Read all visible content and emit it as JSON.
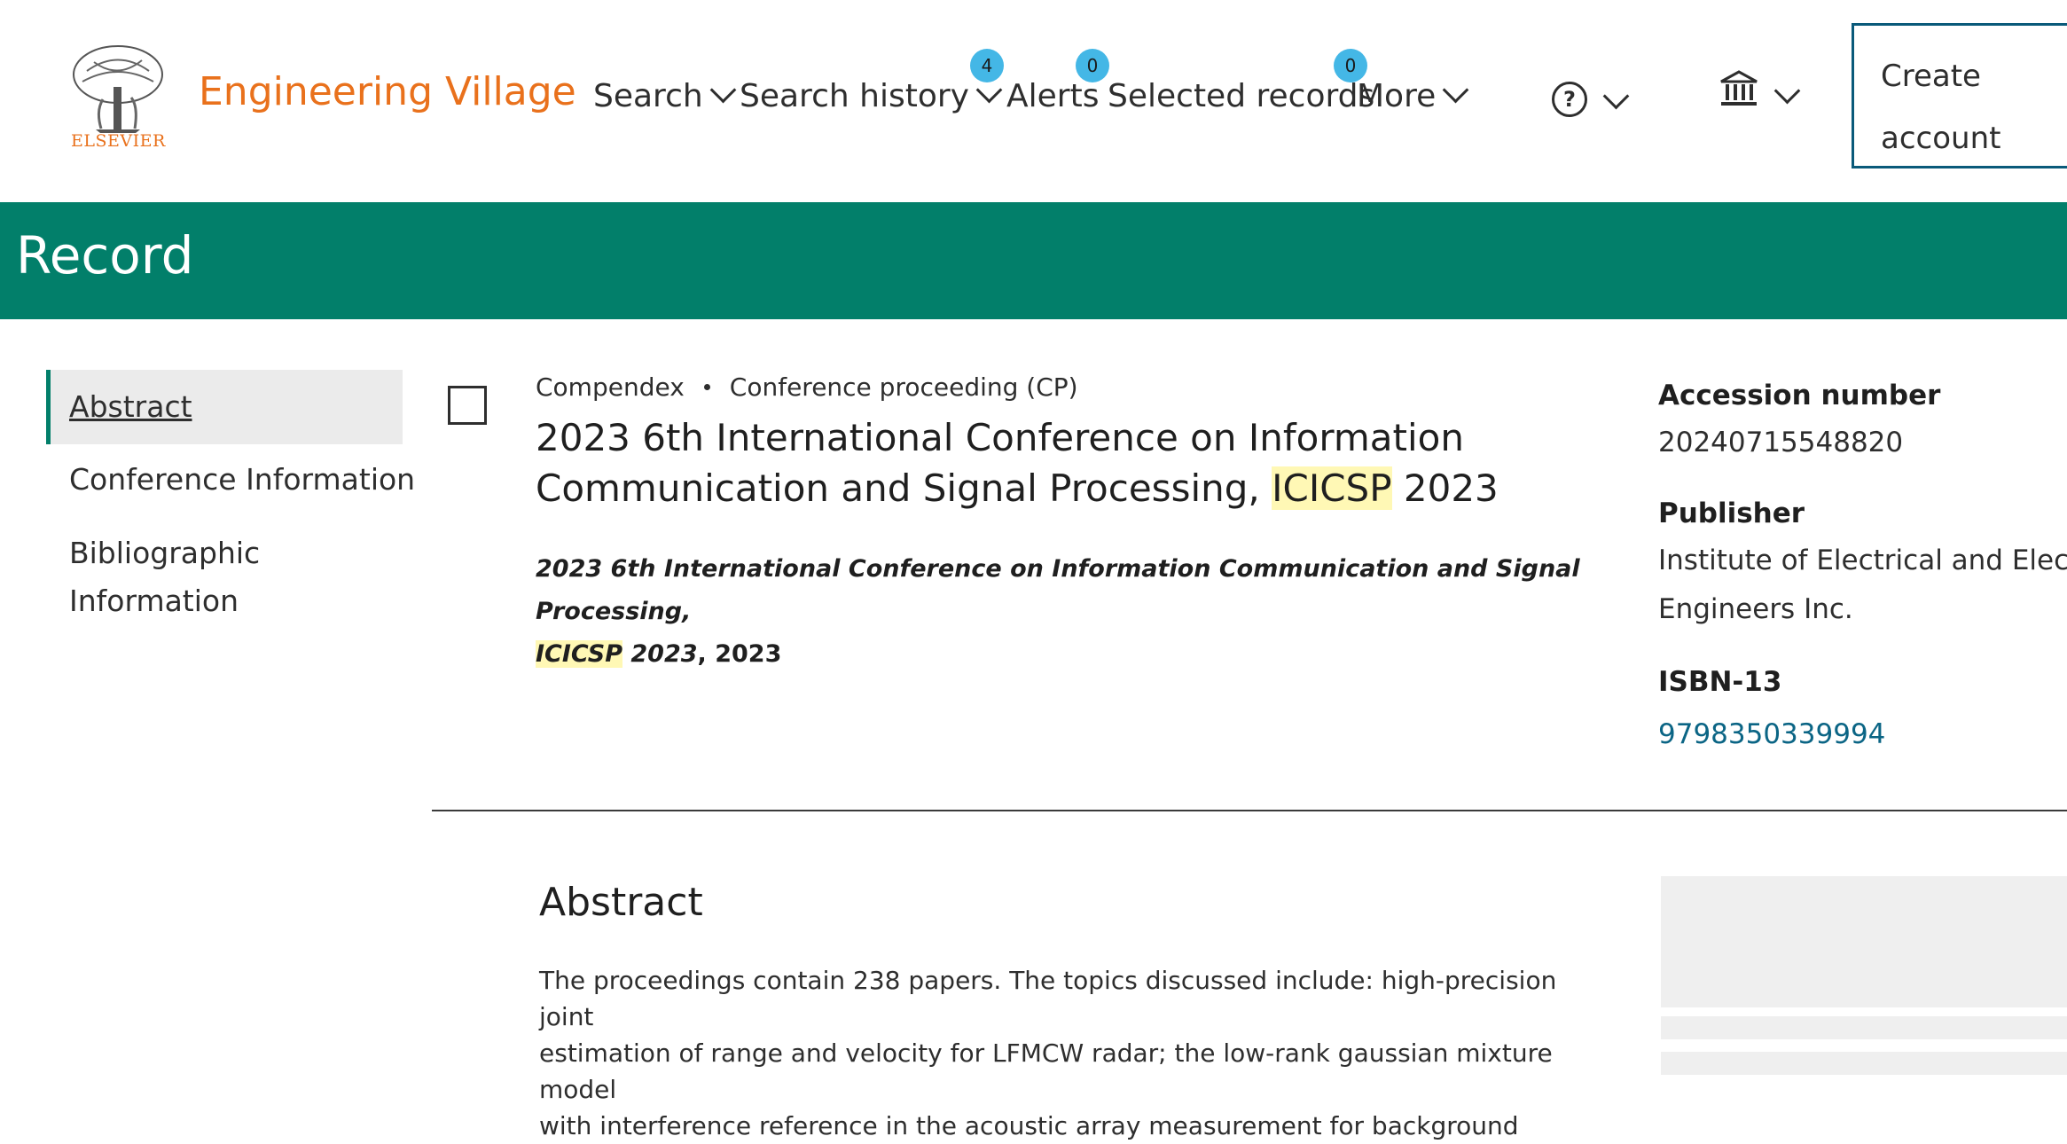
{
  "header": {
    "logo_text": "ELSEVIER",
    "brand": "Engineering Village",
    "nav": {
      "search": "Search",
      "search_history": "Search history",
      "search_history_count": "4",
      "alerts": "Alerts",
      "alerts_count": "0",
      "selected_records": "Selected records",
      "selected_records_count": "0",
      "more": "More"
    },
    "help_glyph": "?",
    "create_account": [
      "Create",
      "account"
    ]
  },
  "band": {
    "title": "Record"
  },
  "sidenav": {
    "items": [
      {
        "label": "Abstract",
        "active": true
      },
      {
        "label": "Conference Information",
        "active": false
      },
      {
        "label": "Bibliographic",
        "label2": "Information",
        "active": false
      }
    ]
  },
  "record": {
    "database": "Compendex",
    "doc_type": "Conference proceeding (CP)",
    "title_line1": "2023 6th International Conference on Information",
    "title_line2_pre": "Communication and Signal Processing, ",
    "title_hl": "ICICSP",
    "title_line2_post": " 2023",
    "source_line1": "2023 6th International Conference on Information Communication and Signal Processing,",
    "source_hl": "ICICSP",
    "source_line2_post": " 2023",
    "source_year": ", 2023"
  },
  "details": {
    "accession_label": "Accession number",
    "accession_value": "20240715548820",
    "publisher_label": "Publisher",
    "publisher_line1": "Institute of Electrical and Elec",
    "publisher_line2": "Engineers Inc.",
    "isbn_label": "ISBN-13",
    "isbn_value": "9798350339994"
  },
  "abstract": {
    "heading": "Abstract",
    "lines": [
      "The proceedings contain 238 papers. The topics discussed include: high-precision joint",
      "estimation of range and velocity for LFMCW radar; the low-rank gaussian mixture model",
      "with interference reference in the acoustic array measurement for background"
    ]
  },
  "colors": {
    "brand": "#e9711c",
    "band": "#027f6a",
    "badge": "#44b7e6",
    "link": "#0b6585",
    "highlight": "#fff8b5"
  }
}
